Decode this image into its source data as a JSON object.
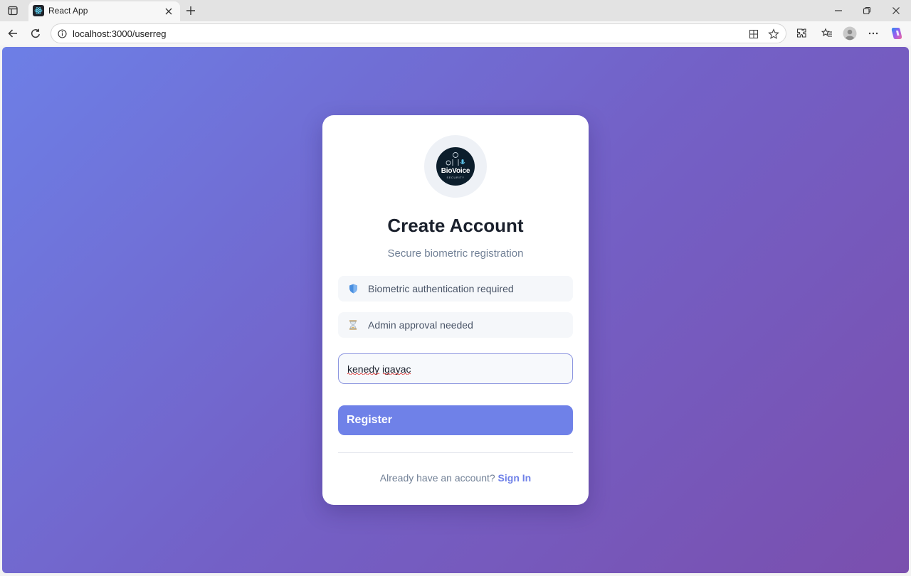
{
  "browser": {
    "tab_title": "React App",
    "url": "localhost:3000/userreg"
  },
  "colors": {
    "accent": "#6f81e8",
    "gradient_start": "#6d7fe6",
    "gradient_end": "#7a4fae"
  },
  "card": {
    "logo_text": "BioVoice",
    "logo_subtext": "SECURITY",
    "title": "Create Account",
    "subtitle": "Secure biometric registration",
    "info_items": [
      {
        "icon": "shield-icon",
        "label": "Biometric authentication required"
      },
      {
        "icon": "hourglass-icon",
        "label": "Admin approval needed"
      }
    ],
    "name_input_value": "kenedy igayac",
    "register_label": "Register",
    "signin_prompt": "Already have an account?",
    "signin_link": "Sign In"
  }
}
